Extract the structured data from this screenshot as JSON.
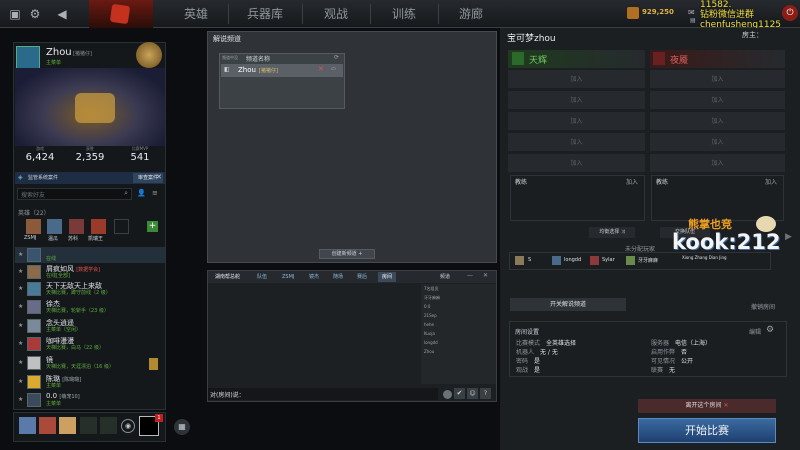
{
  "topbar": {
    "nav_tabs": [
      "英雄",
      "兵器库",
      "观战",
      "训练",
      "游廊"
    ],
    "gold_amount": "929,250",
    "overlay_lines": [
      "11582.",
      "钻粉微信进群",
      "chenfusheng1125",
      "1."
    ],
    "host_label": "房主："
  },
  "profile": {
    "name": "Zhou",
    "tag": "[猪猪仔]",
    "subtitle": "主菜单",
    "stats": [
      {
        "label": "游戏",
        "value": "6,424"
      },
      {
        "label": "获胜",
        "value": "2,359"
      },
      {
        "label": "比赛MVP",
        "value": "541"
      }
    ],
    "case_button": "监管系统案件",
    "review_button": "审查案件"
  },
  "friends": {
    "search_placeholder": "搜索好友",
    "party_header": "英雄（22）",
    "party_members": [
      "ZSMJ",
      "温瓜",
      "苏科",
      "凯瑞王"
    ],
    "list": [
      {
        "name": "",
        "status": "在线"
      },
      {
        "name": "屑疯如风",
        "status": "在线[全部]",
        "tag": "[数据学会]"
      },
      {
        "name": "天下无敌天上来敌",
        "status": "天梯比赛，蹲守前线（2 级）"
      },
      {
        "name": "徐杰",
        "status": "天梯比赛，轮斩手（23 级）"
      },
      {
        "name": "念头逍遥",
        "status": "主菜单（空闲）"
      },
      {
        "name": "咖啡漫漫",
        "status": "天梯比赛，白马（22 级）"
      },
      {
        "name": "镜",
        "status": "天梯比赛，天涯漂泊（16 级）"
      },
      {
        "name": "陈璐",
        "status": "主菜单",
        "tag": "[陈璐璐]"
      },
      {
        "name": "0.0",
        "status": "主菜单",
        "tag": "[萌宠10]"
      }
    ]
  },
  "bottom_bar": {
    "badge_count": "1"
  },
  "commentary": {
    "title": "解说频道",
    "col_left": "频道中没",
    "col_name": "频道名称",
    "row_name": "Zhou",
    "row_tag": "[猪猪仔]",
    "create_button": "创建新频道"
  },
  "chat": {
    "tabs": [
      "湖南帮总舵",
      "队伍",
      "ZSMJ",
      "镜杰",
      "随场",
      "赛后",
      "房间"
    ],
    "list_header": "频道",
    "list_items": [
      "7名组员",
      "牙牙麻麻",
      "0.0",
      "21Sep",
      "hehe",
      "Kuoja",
      "longdd",
      "Zhou"
    ],
    "input_prefix": "对(房间)说："
  },
  "lobby": {
    "title": "宝可梦zhou",
    "radiant_label": "天辉",
    "dire_label": "夜魇",
    "slot_label": "加入",
    "coach_label": "教练",
    "swap_left": "均衡选择",
    "swap_right": "交换队伍",
    "unassigned_label": "未分配玩家",
    "unassigned_players": [
      "S",
      "longdd",
      "Sylar",
      "牙牙麻麻"
    ],
    "toggle_commentary": "开关解说频道",
    "cancel_room": "撤销房间",
    "settings_title": "房间设置",
    "edit_label": "编辑",
    "settings": [
      {
        "k": "比赛模式",
        "v": "全英雄选择"
      },
      {
        "k": "机器人",
        "v": "无 / 无"
      },
      {
        "k": "密码",
        "v": "是"
      },
      {
        "k": "观战",
        "v": "是"
      }
    ],
    "settings_right": [
      {
        "k": "服务器",
        "v": "电信（上海）"
      },
      {
        "k": "启用作弊",
        "v": "否"
      },
      {
        "k": "可见情况",
        "v": "公开"
      },
      {
        "k": "联赛",
        "v": "无"
      }
    ],
    "leave_button": "离开这个房间",
    "start_button": "开始比赛"
  },
  "watermark": {
    "main": "kook:212",
    "top": "熊掌也竞",
    "sub": "Xiong Zhang Dian Jing"
  },
  "colors": {
    "radiant": "#6fcf5f",
    "dire": "#e0605a",
    "gold": "#e0b040",
    "accent_blue": "#2b4e78"
  }
}
